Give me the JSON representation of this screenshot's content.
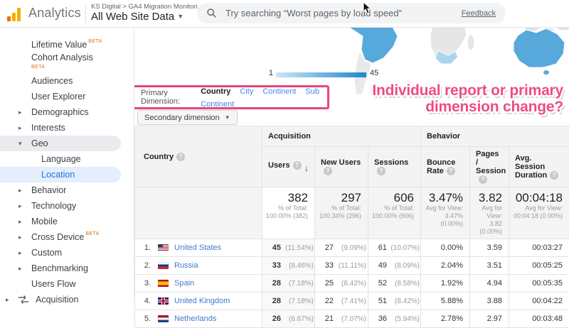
{
  "header": {
    "logo_text": "Analytics",
    "breadcrumb": "KS Digital > GA4 Migration Monitori...",
    "property": "All Web Site Data",
    "search_placeholder": "Try searching “Worst pages by load speed”",
    "feedback": "Feedback"
  },
  "sidebar": {
    "items": [
      {
        "label": "Lifetime Value",
        "beta": "sup"
      },
      {
        "label": "Cohort Analysis",
        "beta": "under"
      },
      {
        "label": "Audiences"
      },
      {
        "label": "User Explorer"
      },
      {
        "label": "Demographics",
        "arrow": "collapsed"
      },
      {
        "label": "Interests",
        "arrow": "collapsed"
      },
      {
        "label": "Geo",
        "arrow": "expanded",
        "highlight": "gray"
      },
      {
        "label": "Language",
        "indent": "sub"
      },
      {
        "label": "Location",
        "indent": "sub",
        "highlight": "blue",
        "selected": true
      },
      {
        "label": "Behavior",
        "arrow": "collapsed"
      },
      {
        "label": "Technology",
        "arrow": "collapsed"
      },
      {
        "label": "Mobile",
        "arrow": "collapsed"
      },
      {
        "label": "Cross Device",
        "arrow": "collapsed",
        "beta": "sup"
      },
      {
        "label": "Custom",
        "arrow": "collapsed"
      },
      {
        "label": "Benchmarking",
        "arrow": "collapsed"
      },
      {
        "label": "Users Flow"
      },
      {
        "label": "Acquisition",
        "arrow": "collapsed",
        "section": true,
        "icon": "acquisition-icon"
      }
    ]
  },
  "map": {
    "legend_min": "1",
    "legend_max": "45"
  },
  "report": {
    "primary_dimension_label": "Primary Dimension:",
    "primary_dimensions": [
      {
        "label": "Country",
        "active": true
      },
      {
        "label": "City",
        "active": false
      },
      {
        "label": "Continent",
        "active": false
      },
      {
        "label": "Sub Continent",
        "active": false
      }
    ],
    "secondary_dimension_label": "Secondary dimension",
    "annotation_line1": "Individual report or primary",
    "annotation_line2": "dimension change?"
  },
  "table": {
    "dimension_header": "Country",
    "group_acquisition": "Acquisition",
    "group_behavior": "Behavior",
    "columns": [
      "Users",
      "New Users",
      "Sessions",
      "Bounce Rate",
      "Pages / Session",
      "Avg. Session Duration"
    ],
    "summary": {
      "users": {
        "big": "382",
        "l1": "% of Total:",
        "l2": "100.00% (382)"
      },
      "new_users": {
        "big": "297",
        "l1": "% of Total:",
        "l2": "100.34% (296)"
      },
      "sessions": {
        "big": "606",
        "l1": "% of Total:",
        "l2": "100.00% (606)"
      },
      "bounce_rate": {
        "big": "3.47%",
        "l1": "Avg for View:",
        "l2": "3.47% (0.00%)"
      },
      "pages_session": {
        "big": "3.82",
        "l1": "Avg for View:",
        "l2": "3.82 (0.00%)"
      },
      "avg_duration": {
        "big": "00:04:18",
        "l1": "Avg for View:",
        "l2": "00:04:18 (0.00%)"
      }
    },
    "rows": [
      {
        "idx": "1.",
        "flag": "us",
        "country": "United States",
        "users": "45",
        "users_pct": "(11.54%)",
        "new_users": "27",
        "new_users_pct": "(9.09%)",
        "sessions": "61",
        "sessions_pct": "(10.07%)",
        "bounce": "0.00%",
        "pages": "3.59",
        "duration": "00:03:27"
      },
      {
        "idx": "2.",
        "flag": "ru",
        "country": "Russia",
        "users": "33",
        "users_pct": "(8.46%)",
        "new_users": "33",
        "new_users_pct": "(11.11%)",
        "sessions": "49",
        "sessions_pct": "(8.09%)",
        "bounce": "2.04%",
        "pages": "3.51",
        "duration": "00:05:25"
      },
      {
        "idx": "3.",
        "flag": "es",
        "country": "Spain",
        "users": "28",
        "users_pct": "(7.18%)",
        "new_users": "25",
        "new_users_pct": "(8.42%)",
        "sessions": "52",
        "sessions_pct": "(8.58%)",
        "bounce": "1.92%",
        "pages": "4.94",
        "duration": "00:05:35"
      },
      {
        "idx": "4.",
        "flag": "gb",
        "country": "United Kingdom",
        "users": "28",
        "users_pct": "(7.18%)",
        "new_users": "22",
        "new_users_pct": "(7.41%)",
        "sessions": "51",
        "sessions_pct": "(8.42%)",
        "bounce": "5.88%",
        "pages": "3.88",
        "duration": "00:04:22"
      },
      {
        "idx": "5.",
        "flag": "nl",
        "country": "Netherlands",
        "users": "26",
        "users_pct": "(6.67%)",
        "new_users": "21",
        "new_users_pct": "(7.07%)",
        "sessions": "36",
        "sessions_pct": "(5.94%)",
        "bounce": "2.78%",
        "pages": "2.97",
        "duration": "00:03:48"
      }
    ]
  },
  "colors": {
    "accent_pink": "#e8457c",
    "link_blue": "#4285f4",
    "selected_blue": "#1a73e8",
    "logo_orange": "#f9ab00",
    "map_blue": "#57a9dc",
    "legend_min_color": "#cde6f6",
    "legend_max_color": "#1b87cc"
  }
}
